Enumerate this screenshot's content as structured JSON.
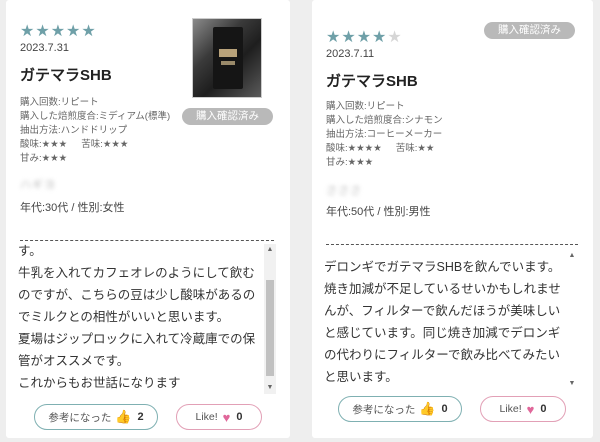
{
  "reviews": [
    {
      "stars_filled": 5,
      "date": "2023.7.31",
      "title": "ガテマラSHB",
      "meta": {
        "purchase_count": "購入回数:リピート",
        "roast_level": "購入した焙煎度合:ミディアム(標準)",
        "extraction": "抽出方法:ハンドドリップ",
        "acidity": "酸味:★★★",
        "bitterness": "苦味:★★★",
        "sweetness": "甘み:★★★"
      },
      "username": "ハギヨ",
      "demographics": "年代:30代 / 性別:女性",
      "verified_badge": "購入確認済み",
      "body": [
        "す。",
        "牛乳を入れてカフェオレのようにして飲むのですが、こちらの豆は少し酸味があるのでミルクとの相性がいいと思います。",
        "夏場はジップロックに入れて冷蔵庫での保管がオススメです。",
        "これからもお世話になります"
      ],
      "helpful_label": "参考になった",
      "helpful_count": "2",
      "like_label": "Like!",
      "like_count": "0"
    },
    {
      "stars_filled": 4,
      "date": "2023.7.11",
      "title": "ガテマラSHB",
      "meta": {
        "purchase_count": "購入回数:リピート",
        "roast_level": "購入した焙煎度合:シナモン",
        "extraction": "抽出方法:コーヒーメーカー",
        "acidity": "酸味:★★★★",
        "bitterness": "苦味:★★",
        "sweetness": "甘み:★★★"
      },
      "username": "さささ",
      "demographics": "年代:50代 / 性別:男性",
      "verified_badge": "購入確認済み",
      "body": [
        "デロンギでガテマラSHBを飲んでいます。焼き加減が不足しているせいかもしれませんが、フィルターで飲んだほうが美味しいと感じています。同じ焼き加減でデロンギの代わりにフィルターで飲み比べてみたいと思います。"
      ],
      "helpful_label": "参考になった",
      "helpful_count": "0",
      "like_label": "Like!",
      "like_count": "0"
    }
  ],
  "colors": {
    "star": "#6fa0a8",
    "star_empty": "#d6d6d6",
    "badge": "#b9b9b9",
    "helpful_border": "#7fb0b2",
    "like_border": "#e2a0b6",
    "heart": "#e0679a"
  },
  "icons": {
    "helpful": "thumbs-up-icon",
    "like": "heart-icon",
    "scroll_up": "scroll-up-arrow-icon",
    "scroll_down": "scroll-down-arrow-icon"
  }
}
